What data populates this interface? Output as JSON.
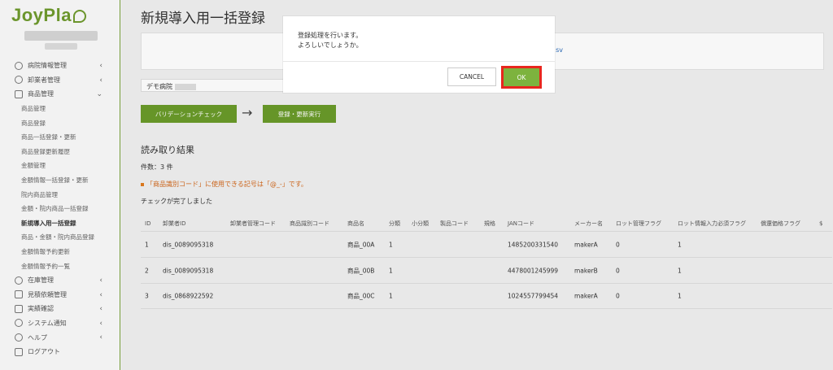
{
  "app": {
    "logo": "JoyPla"
  },
  "sidebar": {
    "items": [
      {
        "label": "病院情報管理",
        "icon": "users-icon",
        "has_chevron": true
      },
      {
        "label": "卸業者管理",
        "icon": "users-icon",
        "has_chevron": true
      },
      {
        "label": "商品管理",
        "icon": "box-icon",
        "has_chevron": true,
        "expanded": true
      }
    ],
    "sub_items": [
      "商品管理",
      "商品登録",
      "商品一括登録・更新",
      "商品登録更新履歴",
      "金額管理",
      "金額情報一括登録・更新",
      "院内商品管理",
      "金額・院内商品一括登録",
      "新規導入用一括登録",
      "商品・金額・院内商品登録",
      "金額情報予約更新",
      "金額情報予約一覧"
    ],
    "bottom_items": [
      {
        "label": "在庫管理",
        "icon": "database-icon",
        "has_chevron": true
      },
      {
        "label": "見積依頼管理",
        "icon": "list-icon",
        "has_chevron": true
      },
      {
        "label": "実績確認",
        "icon": "edit-icon",
        "has_chevron": true
      },
      {
        "label": "システム通知",
        "icon": "info-icon",
        "has_chevron": true
      },
      {
        "label": "ヘルプ",
        "icon": "help-icon",
        "has_chevron": true
      },
      {
        "label": "ログアウト",
        "icon": "logout-icon",
        "has_chevron": false
      }
    ]
  },
  "main": {
    "title": "新規導入用一括登録",
    "csv_link": "sv",
    "hospital_label": "デモ病院",
    "validate_button": "バリデーションチェック",
    "arrow": "→",
    "register_button": "登録・更新実行",
    "section_title": "読み取り結果",
    "count": "件数：3 件",
    "warning": "「商品識別コード」に使用できる記号は「@_-」です。",
    "check_done": "チェックが完了しました",
    "table": {
      "headers": [
        "ID",
        "卸業者ID",
        "卸業者管理コード",
        "商品識別コード",
        "商品名",
        "分類",
        "小分類",
        "製品コード",
        "規格",
        "JANコード",
        "メーカー名",
        "ロット管理フラグ",
        "ロット情報入力必須フラグ",
        "償還価格フラグ",
        "$"
      ],
      "rows": [
        {
          "id": "1",
          "dealer_id": "dis_0089095318",
          "name": "商品_00A",
          "category": "1",
          "jan": "1485200331540",
          "maker": "makerA",
          "lot_flag": "0",
          "lot_required": "1"
        },
        {
          "id": "2",
          "dealer_id": "dis_0089095318",
          "name": "商品_00B",
          "category": "1",
          "jan": "4478001245999",
          "maker": "makerB",
          "lot_flag": "0",
          "lot_required": "1"
        },
        {
          "id": "3",
          "dealer_id": "dis_0868922592",
          "name": "商品_00C",
          "category": "1",
          "jan": "1024557799454",
          "maker": "makerA",
          "lot_flag": "0",
          "lot_required": "1"
        }
      ]
    }
  },
  "modal": {
    "message_line1": "登録処理を行います。",
    "message_line2": "よろしいでしょうか。",
    "cancel_label": "CANCEL",
    "ok_label": "OK",
    "highlight_color": "#e8261e",
    "ok_color": "#7db33e"
  }
}
